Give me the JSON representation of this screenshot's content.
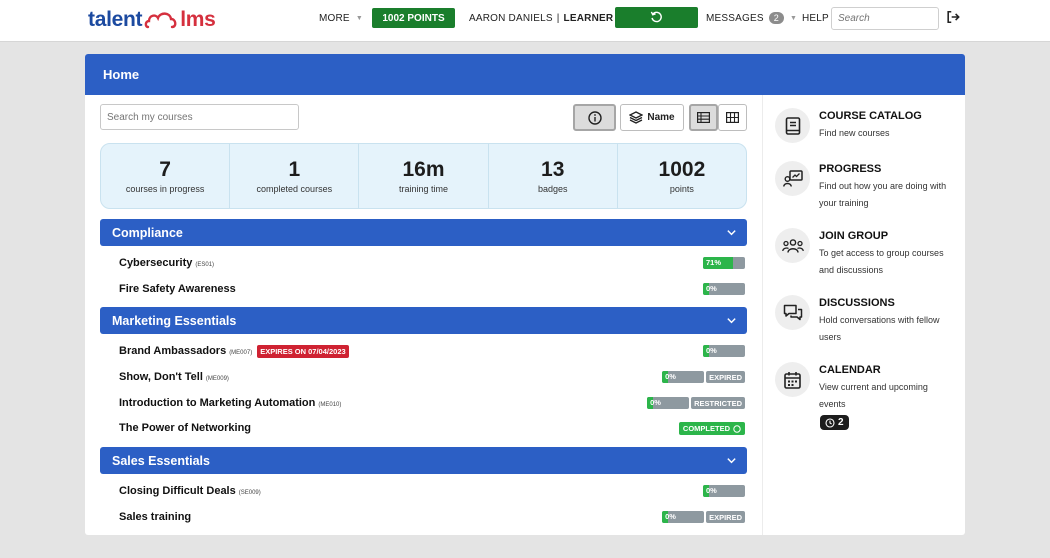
{
  "header": {
    "logo_left": "talent",
    "logo_right": "lms",
    "more_label": "MORE",
    "points_label": "1002 POINTS",
    "user_name": "AARON DANIELS",
    "user_role": "LEARNER",
    "messages_label": "MESSAGES",
    "messages_count": "2",
    "help_label": "HELP",
    "search_placeholder": "Search"
  },
  "page": {
    "title": "Home",
    "course_search_placeholder": "Search my courses",
    "sort_label": "Name"
  },
  "stats": [
    {
      "value": "7",
      "label": "courses in progress"
    },
    {
      "value": "1",
      "label": "completed courses"
    },
    {
      "value": "16m",
      "label": "training time"
    },
    {
      "value": "13",
      "label": "badges"
    },
    {
      "value": "1002",
      "label": "points"
    }
  ],
  "categories": [
    {
      "name": "Compliance",
      "courses": [
        {
          "name": "Cybersecurity",
          "code": "(ES01)",
          "progress": 71,
          "progress_label": "71%"
        },
        {
          "name": "Fire Safety Awareness",
          "code": "",
          "progress": 0,
          "progress_label": "0%"
        }
      ]
    },
    {
      "name": "Marketing Essentials",
      "courses": [
        {
          "name": "Brand Ambassadors",
          "code": "(ME007)",
          "badge": "EXPIRES ON 07/04/2023",
          "progress": 0,
          "progress_label": "0%"
        },
        {
          "name": "Show, Don't Tell",
          "code": "(ME009)",
          "progress": 0,
          "progress_label": "0%",
          "status": "EXPIRED"
        },
        {
          "name": "Introduction to Marketing Automation",
          "code": "(ME010)",
          "progress": 0,
          "progress_label": "0%",
          "status": "RESTRICTED"
        },
        {
          "name": "The Power of Networking",
          "code": "",
          "completed_label": "COMPLETED"
        }
      ]
    },
    {
      "name": "Sales Essentials",
      "courses": [
        {
          "name": "Closing Difficult Deals",
          "code": "(SE009)",
          "progress": 0,
          "progress_label": "0%"
        },
        {
          "name": "Sales training",
          "code": "",
          "progress": 0,
          "progress_label": "0%",
          "status": "EXPIRED"
        }
      ]
    }
  ],
  "shortcuts": [
    {
      "title": "COURSE CATALOG",
      "desc": "Find new courses",
      "icon": "book-icon"
    },
    {
      "title": "PROGRESS",
      "desc": "Find out how you are doing with your training",
      "icon": "progress-chart-icon"
    },
    {
      "title": "JOIN GROUP",
      "desc": "To get access to group courses and discussions",
      "icon": "group-icon"
    },
    {
      "title": "DISCUSSIONS",
      "desc": "Hold conversations with fellow users",
      "icon": "chat-bubbles-icon"
    },
    {
      "title": "CALENDAR",
      "desc": "View current and upcoming events",
      "icon": "calendar-icon"
    }
  ],
  "calendar_count": "2",
  "colors": {
    "brand_blue": "#2c5fc5",
    "logo_blue": "#1c4aa0",
    "logo_red": "#d5303e",
    "points_green": "#1a7e2c",
    "progress_green": "#2cb54a",
    "expires_red": "#cf2232",
    "stats_bg": "#e5f3fb"
  }
}
